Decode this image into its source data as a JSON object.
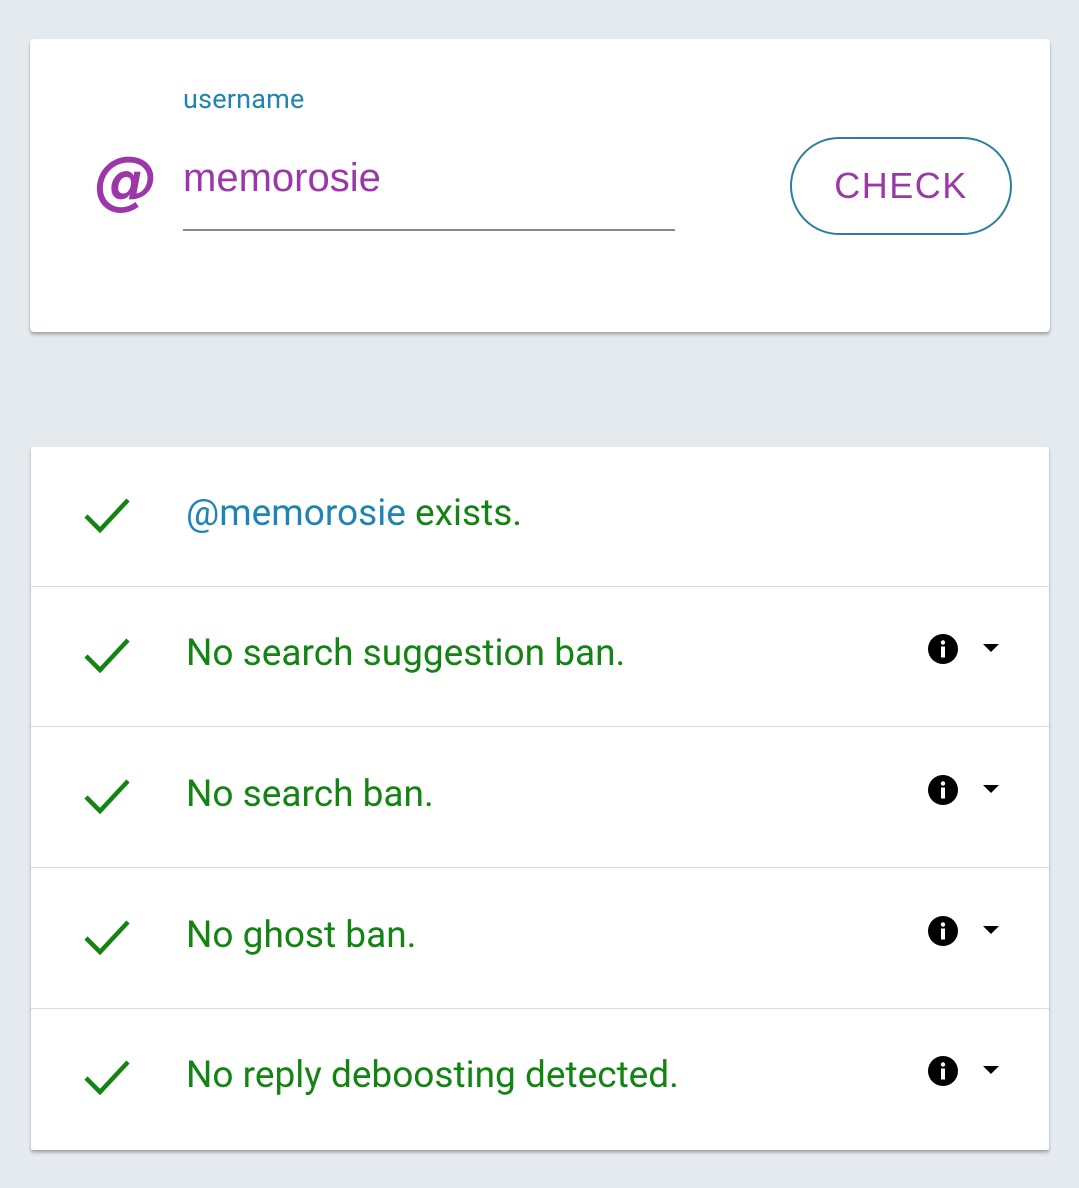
{
  "search": {
    "label": "username",
    "at_symbol": "@",
    "value": "memorosie",
    "button_label": "CHECK"
  },
  "results": {
    "items": [
      {
        "handle": "@memorosie",
        "text": " exists.",
        "status": "ok",
        "has_info": false
      },
      {
        "text": "No search suggestion ban.",
        "status": "ok",
        "has_info": true
      },
      {
        "text": "No search ban.",
        "status": "ok",
        "has_info": true
      },
      {
        "text": "No ghost ban.",
        "status": "ok",
        "has_info": true
      },
      {
        "text": "No reply deboosting detected.",
        "status": "ok",
        "has_info": true
      }
    ]
  },
  "colors": {
    "background": "#e4eaee",
    "accent_purple": "#9c37a9",
    "accent_blue": "#1f84b5",
    "success_green": "#138412"
  },
  "icons": {
    "check": "check-icon",
    "info": "info-icon",
    "caret": "caret-down-icon"
  }
}
